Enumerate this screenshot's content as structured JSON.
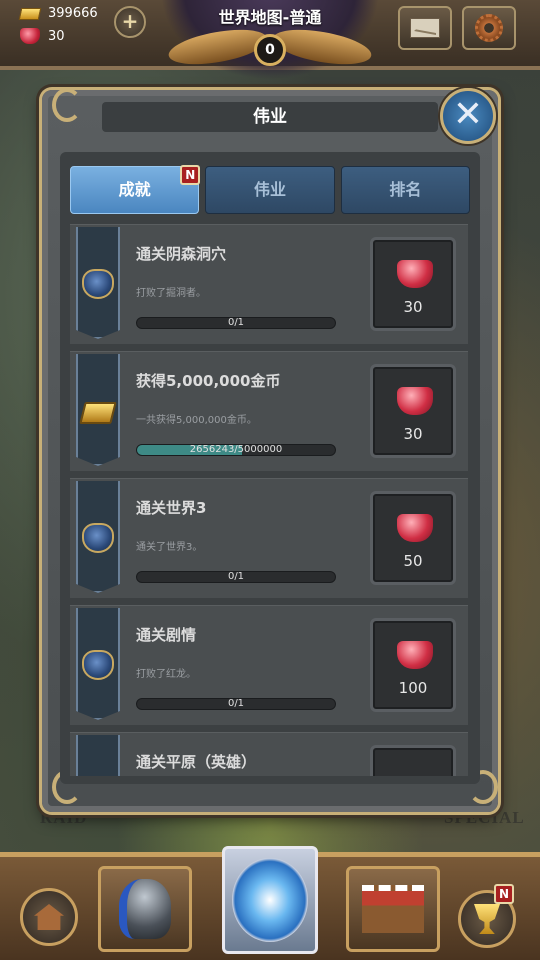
{
  "resources": {
    "gold": "399666",
    "gems": "30",
    "add_label": "+"
  },
  "world": {
    "title": "世界地图-普通",
    "badge_count": "0"
  },
  "background_labels": {
    "left": "RAID",
    "right": "SPECIAL"
  },
  "modal": {
    "title": "伟业",
    "close_label": "✕"
  },
  "tabs": [
    {
      "label": "成就",
      "active": true,
      "badge": "N"
    },
    {
      "label": "伟业",
      "active": false
    },
    {
      "label": "排名",
      "active": false
    }
  ],
  "achievements": [
    {
      "title": "通关阴森洞穴",
      "desc": "打败了掘洞者。",
      "progress_text": "0/1",
      "progress": 0,
      "reward": "30",
      "icon": "shield-crest-icon"
    },
    {
      "title": "获得5,000,000金币",
      "desc": "一共获得5,000,000金币。",
      "progress_text": "2656243/5000000",
      "progress": 0.531,
      "reward": "30",
      "icon": "gold-bars-icon"
    },
    {
      "title": "通关世界3",
      "desc": "通关了世界3。",
      "progress_text": "0/1",
      "progress": 0,
      "reward": "50",
      "icon": "shield-crest-icon"
    },
    {
      "title": "通关剧情",
      "desc": "打败了红龙。",
      "progress_text": "0/1",
      "progress": 0,
      "reward": "100",
      "icon": "shield-crest-icon"
    },
    {
      "title": "通关平原（英雄）",
      "desc": "",
      "progress_text": "",
      "progress": 0,
      "reward": "",
      "icon": "shield-crest-icon"
    }
  ],
  "bottom_nav": {
    "badge": "N",
    "items": [
      "home-icon",
      "hero-helmet-icon",
      "portal-icon",
      "shop-icon",
      "trophy-icon"
    ]
  },
  "colors": {
    "tab_active": "#4a86c0",
    "progress_fill": "#3e8a86",
    "badge_red": "#a82020",
    "frame_gold": "#c8b078"
  }
}
